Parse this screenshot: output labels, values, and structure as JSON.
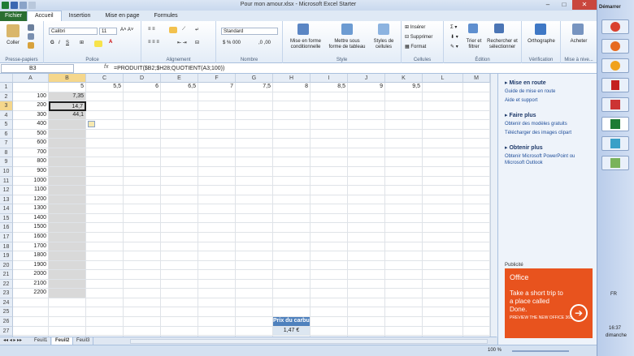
{
  "window": {
    "title": "Pour mon amour.xlsx - Microsoft Excel Starter"
  },
  "tabs": [
    "Fichier",
    "Accueil",
    "Insertion",
    "Mise en page",
    "Formules"
  ],
  "ribbon": {
    "clipboard": {
      "paste": "Coller",
      "group": "Presse-papiers"
    },
    "font": {
      "name": "Calibri",
      "size": "11",
      "group": "Police"
    },
    "alignment": {
      "group": "Alignement"
    },
    "number": {
      "format": "Standard",
      "group": "Nombre"
    },
    "style": {
      "cond": "Mise en forme conditionnelle",
      "table": "Mettre sous forme de tableau",
      "cells_style": "Styles de cellules",
      "group": "Style"
    },
    "cells": {
      "insert": "Insérer",
      "delete": "Supprimer",
      "format": "Format",
      "group": "Cellules"
    },
    "editing": {
      "sort": "Trier et filtrer",
      "find": "Rechercher et sélectionner",
      "group": "Édition"
    },
    "proofing": {
      "spell": "Orthographe",
      "group": "Vérification"
    },
    "update": {
      "buy": "Acheter",
      "group": "Mise à nive..."
    }
  },
  "formula_bar": {
    "name_box": "B3",
    "fx": "fx",
    "formula": "=PRODUIT($B2;$H28;QUOTIENT(A3;100))"
  },
  "columns": [
    "A",
    "B",
    "C",
    "D",
    "E",
    "F",
    "G",
    "H",
    "I",
    "J",
    "K",
    "L",
    "M"
  ],
  "rows": [
    {
      "n": "1",
      "A": "",
      "B": "5",
      "C": "5,5",
      "D": "6",
      "E": "6,5",
      "F": "7",
      "G": "7,5",
      "H": "8",
      "I": "8,5",
      "J": "9",
      "K": "9,5"
    },
    {
      "n": "2",
      "A": "100",
      "B": "7,35"
    },
    {
      "n": "3",
      "A": "200",
      "B": "14,7"
    },
    {
      "n": "4",
      "A": "300",
      "B": "44,1"
    },
    {
      "n": "5",
      "A": "400"
    },
    {
      "n": "6",
      "A": "500"
    },
    {
      "n": "7",
      "A": "600"
    },
    {
      "n": "8",
      "A": "700"
    },
    {
      "n": "9",
      "A": "800"
    },
    {
      "n": "10",
      "A": "900"
    },
    {
      "n": "11",
      "A": "1000"
    },
    {
      "n": "12",
      "A": "1100"
    },
    {
      "n": "13",
      "A": "1200"
    },
    {
      "n": "14",
      "A": "1300"
    },
    {
      "n": "15",
      "A": "1400"
    },
    {
      "n": "16",
      "A": "1500"
    },
    {
      "n": "17",
      "A": "1600"
    },
    {
      "n": "18",
      "A": "1700"
    },
    {
      "n": "19",
      "A": "1800"
    },
    {
      "n": "20",
      "A": "1900"
    },
    {
      "n": "21",
      "A": "2000"
    },
    {
      "n": "22",
      "A": "2100"
    },
    {
      "n": "23",
      "A": "2200"
    },
    {
      "n": "24"
    },
    {
      "n": "25"
    },
    {
      "n": "26",
      "H": "Prix du carburant"
    },
    {
      "n": "27",
      "H": "1,47 €"
    },
    {
      "n": "28"
    }
  ],
  "sheets": [
    "Feuil1",
    "Feuil2",
    "Feuil3"
  ],
  "status": {
    "zoom": "100 %"
  },
  "pane": {
    "h1": "Mise en route",
    "l1a": "Guide de mise en route",
    "l1b": "Aide et support",
    "h2": "Faire plus",
    "l2a": "Obtenir des modèles gratuits",
    "l2b": "Télécharger des images clipart",
    "h3": "Obtenir plus",
    "l3a": "Obtenir Microsoft PowerPoint ou Microsoft Outlook",
    "pub": "Publicité",
    "ad_brand": "Office",
    "ad_text": "Take a short trip to a place called Done.",
    "ad_strip": "PREVIEW THE NEW OFFICE 365"
  },
  "taskbar": {
    "start": "Démarrer",
    "lang": "FR",
    "time": "16:37",
    "day": "dimanche"
  }
}
